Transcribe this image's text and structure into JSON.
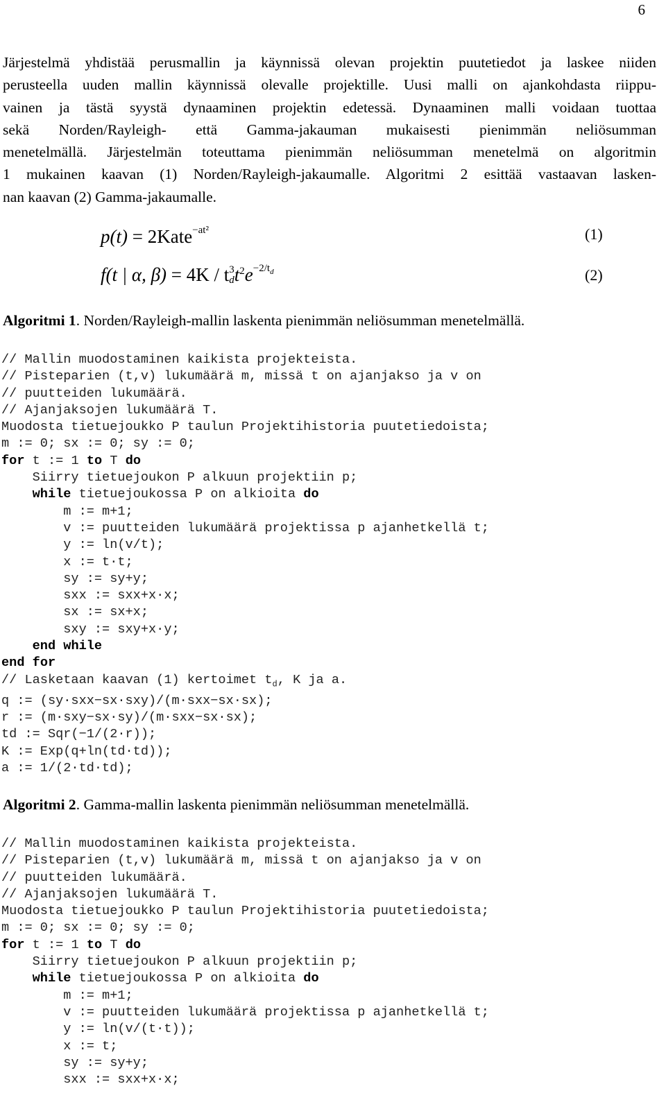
{
  "page_number": "6",
  "intro_lines": [
    "Järjestelmä yhdistää perusmallin ja käynnissä olevan projektin puutetiedot ja laskee niiden",
    "perusteella uuden mallin käynnissä olevalle projektille. Uusi malli on ajankohdasta riippu-",
    "vainen ja tästä syystä dynaaminen projektin edetessä. Dynaaminen malli voidaan tuottaa",
    "sekä Norden/Rayleigh- että Gamma-jakauman mukaisesti pienimmän neliösumman",
    "menetelmällä. Järjestelmän toteuttama pienimmän neliösumman menetelmä on algoritmin",
    "1 mukainen kaavan (1) Norden/Rayleigh-jakaumalle. Algoritmi 2 esittää vastaavan lasken-",
    "nan kaavan (2) Gamma-jakaumalle."
  ],
  "equations": [
    {
      "lhs": "p(t)",
      "rhs_base": "= 2Kate",
      "rhs_exp": "−at²",
      "number": "(1)"
    },
    {
      "lhs": "f(t | α, β)",
      "rhs_pre": "= 4K / t",
      "td_sup": "3",
      "td_sub": "d",
      "t2": "t",
      "t2_sup": "2",
      "e": "e",
      "e_exp": "−2/t",
      "e_exp_sub": "d",
      "number": "(2)"
    }
  ],
  "algorithm1": {
    "caption_bold": "Algoritmi 1",
    "caption_text": ". Norden/Rayleigh-mallin laskenta pienimmän neliösumman menetelmällä.",
    "lines": [
      "// Mallin muodostaminen kaikista projekteista.",
      "// Pisteparien (t,v) lukumäärä m, missä t on ajanjakso ja v on",
      "// puutteiden lukumäärä.",
      "// Ajanjaksojen lukumäärä T.",
      "Muodosta tietuejoukko P taulun Projektihistoria puutetiedoista;",
      "m := 0; sx := 0; sy := 0;",
      "@for t := 1 to T do",
      "    Siirry tietuejoukon P alkuun projektiin p;",
      "@    while tietuejoukossa P on alkioita do",
      "        m := m+1;",
      "        v := puutteiden lukumäärä projektissa p ajanhetkellä t;",
      "        y := ln(v/t);",
      "        x := t·t;",
      "        sy := sy+y;",
      "        sxx := sxx+x·x;",
      "        sx := sx+x;",
      "        sxy := sxy+x·y;",
      "@    end while",
      "@end for",
      "#// Lasketaan kaavan (1) kertoimet t_d, K ja a.",
      "q := (sy·sxx−sx·sxy)/(m·sxx−sx·sx);",
      "r := (m·sxy−sx·sy)/(m·sxx−sx·sx);",
      "td := Sqr(−1/(2·r));",
      "K := Exp(q+ln(td·td));",
      "a := 1/(2·td·td);"
    ]
  },
  "algorithm2": {
    "caption_bold": "Algoritmi 2",
    "caption_text": ". Gamma-mallin laskenta pienimmän neliösumman menetelmällä.",
    "lines": [
      "// Mallin muodostaminen kaikista projekteista.",
      "// Pisteparien (t,v) lukumäärä m, missä t on ajanjakso ja v on",
      "// puutteiden lukumäärä.",
      "// Ajanjaksojen lukumäärä T.",
      "Muodosta tietuejoukko P taulun Projektihistoria puutetiedoista;",
      "m := 0; sx := 0; sy := 0;",
      "@for t := 1 to T do",
      "    Siirry tietuejoukon P alkuun projektiin p;",
      "@    while tietuejoukossa P on alkioita do",
      "        m := m+1;",
      "        v := puutteiden lukumäärä projektissa p ajanhetkellä t;",
      "        y := ln(v/(t·t));",
      "        x := t;",
      "        sy := sy+y;",
      "        sxx := sxx+x·x;"
    ]
  }
}
